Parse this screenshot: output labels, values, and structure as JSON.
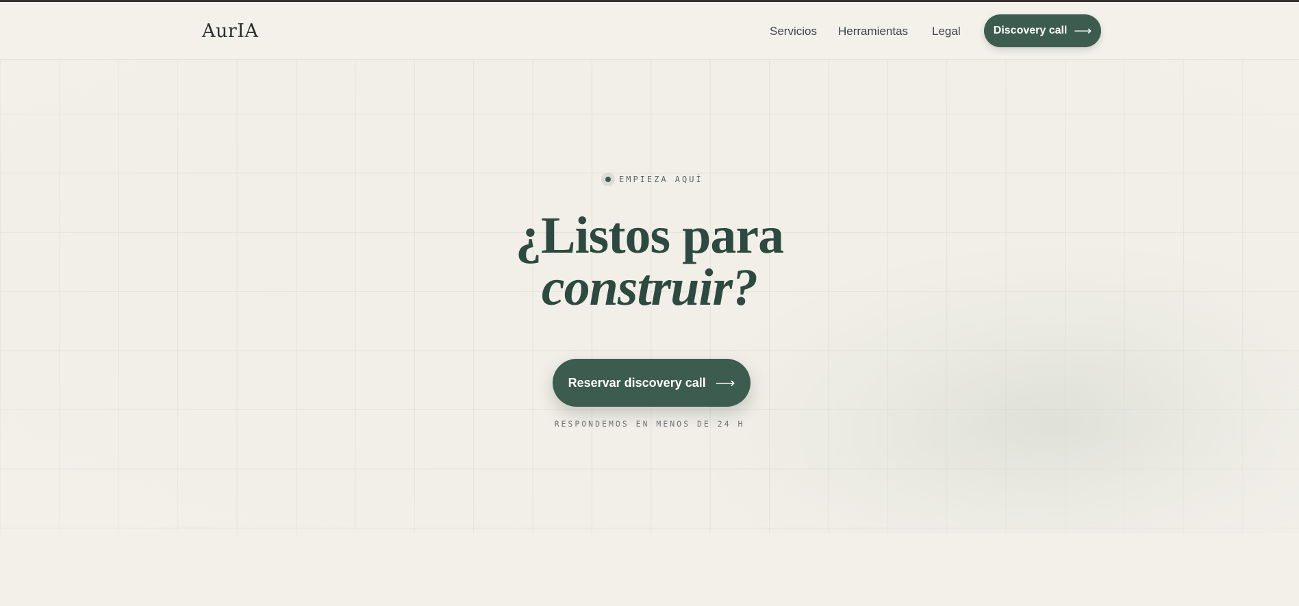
{
  "brand": {
    "logo": "AurIA"
  },
  "nav": {
    "items": [
      {
        "label": "Servicios"
      },
      {
        "label": "Herramientas"
      },
      {
        "label": "Legal"
      }
    ],
    "cta": {
      "label": "Discovery call",
      "icon": "arrow-right-icon"
    }
  },
  "hero": {
    "eyebrow": "EMPIEZA AQUÍ",
    "headline_line1": "¿Listos para",
    "headline_line2": "construir?",
    "cta": {
      "label": "Reservar discovery call",
      "icon": "arrow-right-icon"
    },
    "note": "RESPONDEMOS EN MENOS DE 24 H"
  },
  "colors": {
    "accent": "#3d5c50",
    "background": "#f3f0ea",
    "top_rule": "#3a2f2c"
  }
}
